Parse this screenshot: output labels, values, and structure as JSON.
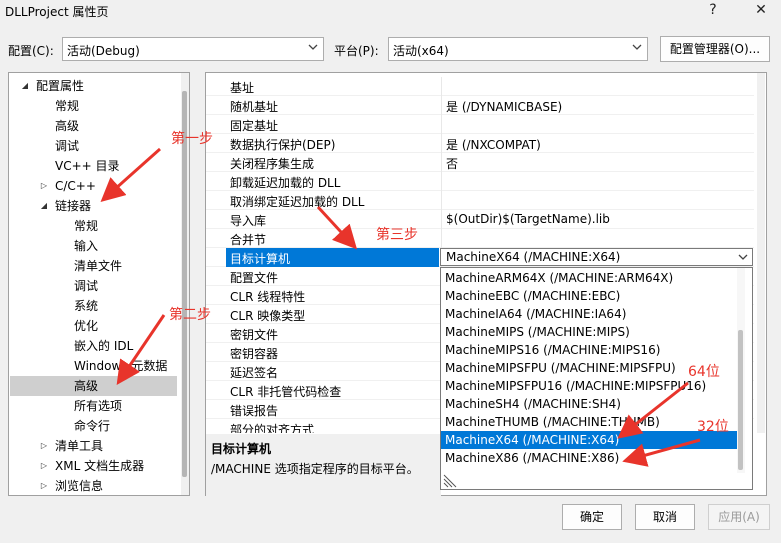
{
  "window": {
    "title": "DLLProject 属性页",
    "help": "?",
    "close": "✕"
  },
  "config": {
    "label": "配置(C):",
    "value": "活动(Debug)"
  },
  "platform": {
    "label": "平台(P):",
    "value": "活动(x64)"
  },
  "config_manager_label": "配置管理器(O)...",
  "tree": [
    {
      "label": "配置属性",
      "expander": "◢"
    },
    {
      "label": "常规"
    },
    {
      "label": "高级"
    },
    {
      "label": "调试"
    },
    {
      "label": "VC++ 目录"
    },
    {
      "label": "C/C++",
      "expander": "▷"
    },
    {
      "label": "链接器",
      "expander": "◢"
    },
    {
      "label": "常规"
    },
    {
      "label": "输入"
    },
    {
      "label": "清单文件"
    },
    {
      "label": "调试"
    },
    {
      "label": "系统"
    },
    {
      "label": "优化"
    },
    {
      "label": "嵌入的 IDL"
    },
    {
      "label": "Windows 元数据"
    },
    {
      "label": "高级"
    },
    {
      "label": "所有选项"
    },
    {
      "label": "命令行"
    },
    {
      "label": "清单工具",
      "expander": "▷"
    },
    {
      "label": "XML 文档生成器",
      "expander": "▷"
    },
    {
      "label": "浏览信息",
      "expander": "▷"
    }
  ],
  "properties": [
    {
      "name": "基址",
      "value": ""
    },
    {
      "name": "随机基址",
      "value": "是 (/DYNAMICBASE)"
    },
    {
      "name": "固定基址",
      "value": ""
    },
    {
      "name": "数据执行保护(DEP)",
      "value": "是 (/NXCOMPAT)"
    },
    {
      "name": "关闭程序集生成",
      "value": "否"
    },
    {
      "name": "卸载延迟加载的 DLL",
      "value": ""
    },
    {
      "name": "取消绑定延迟加载的 DLL",
      "value": ""
    },
    {
      "name": "导入库",
      "value": "$(OutDir)$(TargetName).lib"
    },
    {
      "name": "合并节",
      "value": ""
    },
    {
      "name": "目标计算机",
      "value": "MachineX64 (/MACHINE:X64)"
    },
    {
      "name": "配置文件",
      "value": ""
    },
    {
      "name": "CLR 线程特性",
      "value": ""
    },
    {
      "name": "CLR 映像类型",
      "value": ""
    },
    {
      "name": "密钥文件",
      "value": ""
    },
    {
      "name": "密钥容器",
      "value": ""
    },
    {
      "name": "延迟签名",
      "value": ""
    },
    {
      "name": "CLR 非托管代码检查",
      "value": ""
    },
    {
      "name": "错误报告",
      "value": ""
    },
    {
      "name": "部分的对齐方式",
      "value": ""
    }
  ],
  "dropdown_options": [
    "MachineARM64X (/MACHINE:ARM64X)",
    "MachineEBC (/MACHINE:EBC)",
    "MachineIA64 (/MACHINE:IA64)",
    "MachineMIPS (/MACHINE:MIPS)",
    "MachineMIPS16 (/MACHINE:MIPS16)",
    "MachineMIPSFPU (/MACHINE:MIPSFPU)",
    "MachineMIPSFPU16 (/MACHINE:MIPSFPU16)",
    "MachineSH4 (/MACHINE:SH4)",
    "MachineTHUMB (/MACHINE:THUMB)",
    "MachineX64 (/MACHINE:X64)",
    "MachineX86 (/MACHINE:X86)"
  ],
  "description": {
    "title": "目标计算机",
    "text": "/MACHINE 选项指定程序的目标平台。"
  },
  "buttons": {
    "ok": "确定",
    "cancel": "取消",
    "apply": "应用(A)"
  },
  "annotations": {
    "step1": "第一步",
    "step2": "第二步",
    "step3": "第三步",
    "x64": "64位",
    "x86": "32位"
  },
  "colors": {
    "accent": "#0078d7",
    "annotation": "#e8342b"
  }
}
